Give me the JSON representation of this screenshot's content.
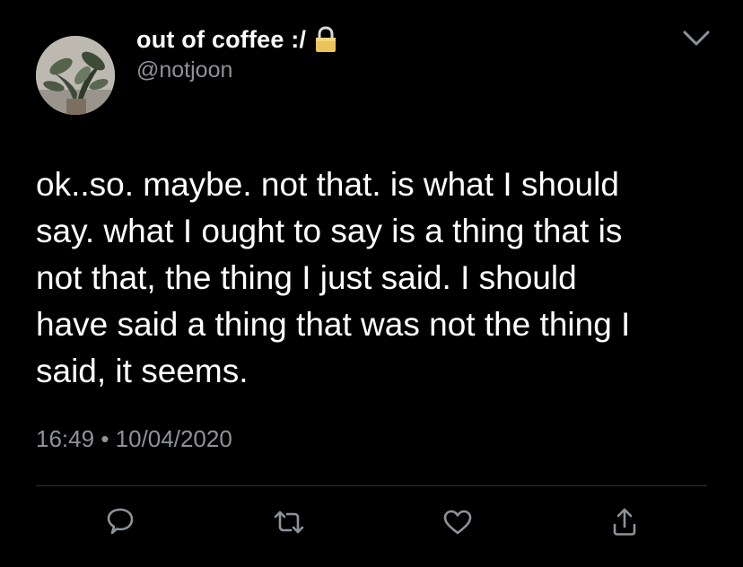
{
  "tweet": {
    "display_name": "out of coffee :/",
    "handle": "@notjoon",
    "text_lines": [
      "ok..so. maybe. not that. is what I should",
      "say. what I ought to say is a thing that is",
      "not that, the thing I just said. I should",
      "have said a thing that was not the thing I",
      "said, it seems."
    ],
    "time": "16:49",
    "separator": "•",
    "date": "10/04/2020",
    "protected_account_icon": "lock-icon"
  },
  "icons": {
    "menu": "chevron-down-icon",
    "reply": "reply-icon",
    "retweet": "retweet-icon",
    "like": "heart-icon",
    "share": "share-icon"
  },
  "colors": {
    "background": "#000000",
    "primary_text": "#ffffff",
    "secondary_text": "#8d9399",
    "divider": "#2f3336",
    "icon": "#8d9399"
  }
}
